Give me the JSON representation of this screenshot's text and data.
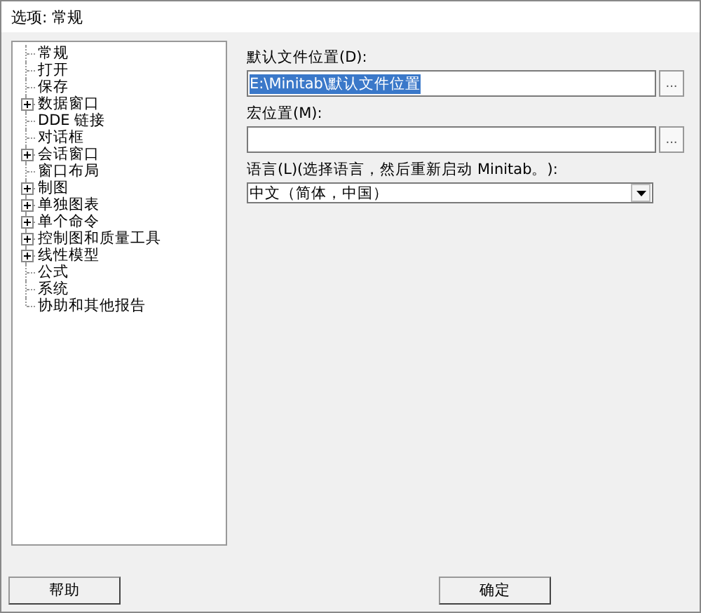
{
  "window": {
    "title": "选项: 常规"
  },
  "tree": {
    "items": [
      {
        "label": "常规",
        "expandable": false
      },
      {
        "label": "打开",
        "expandable": false
      },
      {
        "label": "保存",
        "expandable": false
      },
      {
        "label": "数据窗口",
        "expandable": true
      },
      {
        "label": "DDE 链接",
        "expandable": false
      },
      {
        "label": "对话框",
        "expandable": false
      },
      {
        "label": "会话窗口",
        "expandable": true
      },
      {
        "label": "窗口布局",
        "expandable": false
      },
      {
        "label": "制图",
        "expandable": true
      },
      {
        "label": "单独图表",
        "expandable": true
      },
      {
        "label": "单个命令",
        "expandable": true
      },
      {
        "label": "控制图和质量工具",
        "expandable": true
      },
      {
        "label": "线性模型",
        "expandable": true
      },
      {
        "label": "公式",
        "expandable": false
      },
      {
        "label": "系统",
        "expandable": false
      },
      {
        "label": "协助和其他报告",
        "expandable": false
      }
    ]
  },
  "fields": [
    {
      "kind": "path",
      "label": "默认文件位置(D):",
      "value": "E:\\Minitab\\默认文件位置",
      "selected": true,
      "browse": "..."
    },
    {
      "kind": "path",
      "label": "宏位置(M):",
      "browse": "..."
    },
    {
      "kind": "dropdown",
      "label": "语言(L)(选择语言，然后重新启动 Minitab。):",
      "value": "中文（简体，中国）"
    }
  ],
  "buttons": [
    {
      "label": "帮助"
    },
    {
      "label": "确定"
    }
  ]
}
